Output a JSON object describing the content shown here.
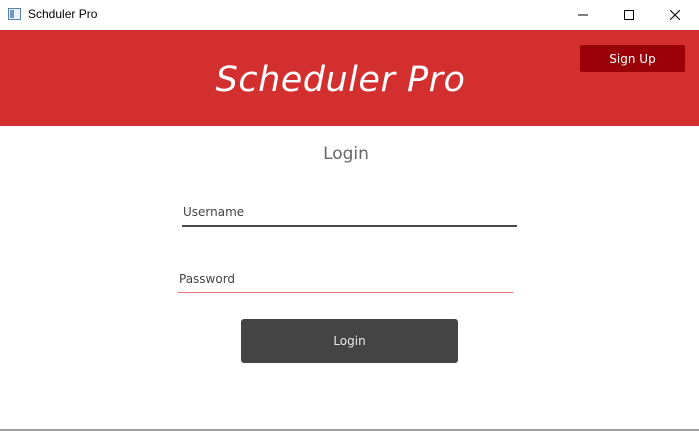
{
  "window": {
    "title": "Schduler Pro",
    "icons": {
      "app": "app-window-icon",
      "minimize": "minimize-icon",
      "maximize": "maximize-icon",
      "close": "close-icon"
    }
  },
  "header": {
    "brand": "Scheduler Pro",
    "signup_label": "Sign Up",
    "colors": {
      "header_bg": "#d32f2f",
      "signup_bg": "#9a0007"
    }
  },
  "login": {
    "heading": "Login",
    "username_placeholder": "Username",
    "password_placeholder": "Password",
    "button_label": "Login",
    "colors": {
      "button_bg": "#444444",
      "password_underline": "#e57373"
    }
  }
}
